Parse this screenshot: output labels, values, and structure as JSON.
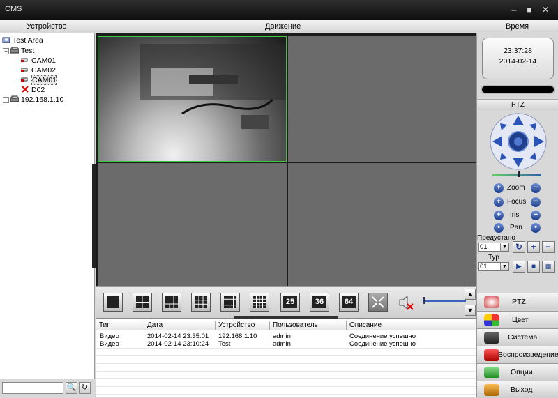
{
  "window": {
    "title": "CMS",
    "minimize_glyph": "–",
    "maximize_glyph": "■",
    "close_glyph": "✕"
  },
  "menu": {
    "device": "Устройство",
    "motion": "Движение",
    "time": "Время"
  },
  "tree": {
    "root": "Test Area",
    "group": "Test",
    "cams": [
      "CAM01",
      "CAM02",
      "CAM01",
      "D02"
    ],
    "ip": "192.168.1.10",
    "expand_glyph": "+",
    "collapse_glyph": "−"
  },
  "search": {
    "placeholder": "",
    "search_glyph": "🔍",
    "refresh_glyph": "↻"
  },
  "clock": {
    "time": "23:37:28",
    "date": "2014-02-14"
  },
  "ptz": {
    "title": "PTZ",
    "zoom": "Zoom",
    "focus": "Focus",
    "iris": "Iris",
    "pan": "Pan",
    "preset_label": "Предустано",
    "preset_value": "01",
    "tour_label": "Тур",
    "tour_value": "01",
    "plus": "+",
    "minus": "−",
    "dot": "•"
  },
  "layout_buttons": [
    "25",
    "36",
    "64"
  ],
  "log": {
    "headers": [
      "Тип",
      "Дата",
      "Устройство",
      "Пользователь",
      "Описание"
    ],
    "rows": [
      [
        "Видео",
        "2014-02-14 23:35:01",
        "192.168.1.10",
        "admin",
        "Соединение успешно"
      ],
      [
        "Видео",
        "2014-02-14 23:10:24",
        "Test",
        "admin",
        "Соединение успешно"
      ]
    ]
  },
  "nav": {
    "ptz": "PTZ",
    "color": "Цвет",
    "system": "Система",
    "playback": "Воспроизведение",
    "options": "Опции",
    "exit": "Выход"
  },
  "colors": {
    "active_border": "#3cc83c",
    "ptz_blue": "#1f3f8c"
  }
}
